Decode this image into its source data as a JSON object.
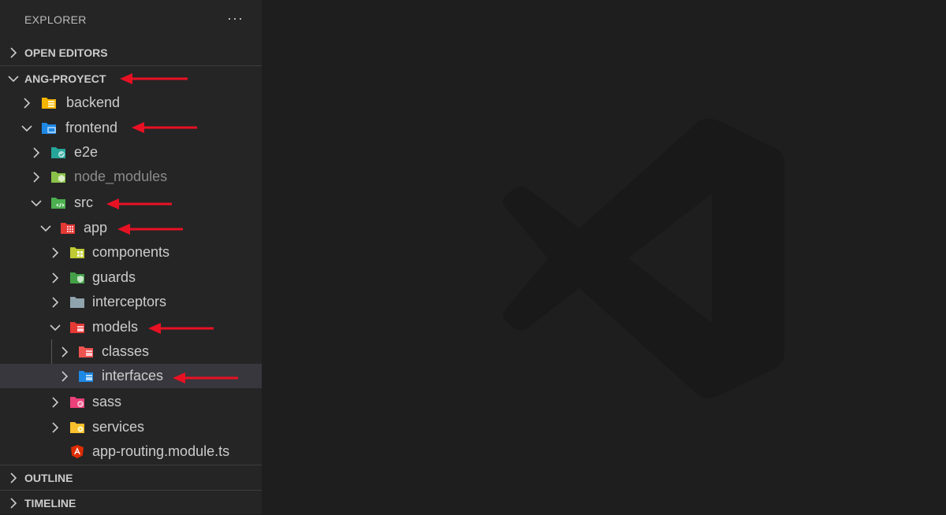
{
  "explorer": {
    "title": "EXPLORER",
    "more": "···"
  },
  "sections": {
    "open_editors": "OPEN EDITORS",
    "project": "ANG-PROYECT",
    "outline": "OUTLINE",
    "timeline": "TIMELINE"
  },
  "tree": [
    {
      "name": "backend",
      "expanded": false,
      "icon": "folder-database-icon"
    },
    {
      "name": "frontend",
      "expanded": true,
      "icon": "folder-frontend-icon"
    },
    {
      "name": "e2e",
      "expanded": false,
      "icon": "folder-e2e-icon"
    },
    {
      "name": "node_modules",
      "expanded": false,
      "icon": "folder-node-icon"
    },
    {
      "name": "src",
      "expanded": true,
      "icon": "folder-src-icon"
    },
    {
      "name": "app",
      "expanded": true,
      "icon": "folder-app-icon"
    },
    {
      "name": "components",
      "expanded": false,
      "icon": "folder-components-icon"
    },
    {
      "name": "guards",
      "expanded": false,
      "icon": "folder-guards-icon"
    },
    {
      "name": "interceptors",
      "expanded": false,
      "icon": "folder-interceptors-icon"
    },
    {
      "name": "models",
      "expanded": true,
      "icon": "folder-models-icon"
    },
    {
      "name": "classes",
      "expanded": false,
      "icon": "folder-classes-icon"
    },
    {
      "name": "interfaces",
      "expanded": false,
      "icon": "folder-interfaces-icon",
      "selected": true
    },
    {
      "name": "sass",
      "expanded": false,
      "icon": "folder-sass-icon"
    },
    {
      "name": "services",
      "expanded": false,
      "icon": "folder-services-icon"
    },
    {
      "name": "app-routing.module.ts",
      "icon": "angular-file-icon"
    }
  ],
  "colors": {
    "editor_bg": "#1e1e1e",
    "sidebar_bg": "#252526",
    "selection": "#37373d",
    "arrow": "#e81123"
  }
}
